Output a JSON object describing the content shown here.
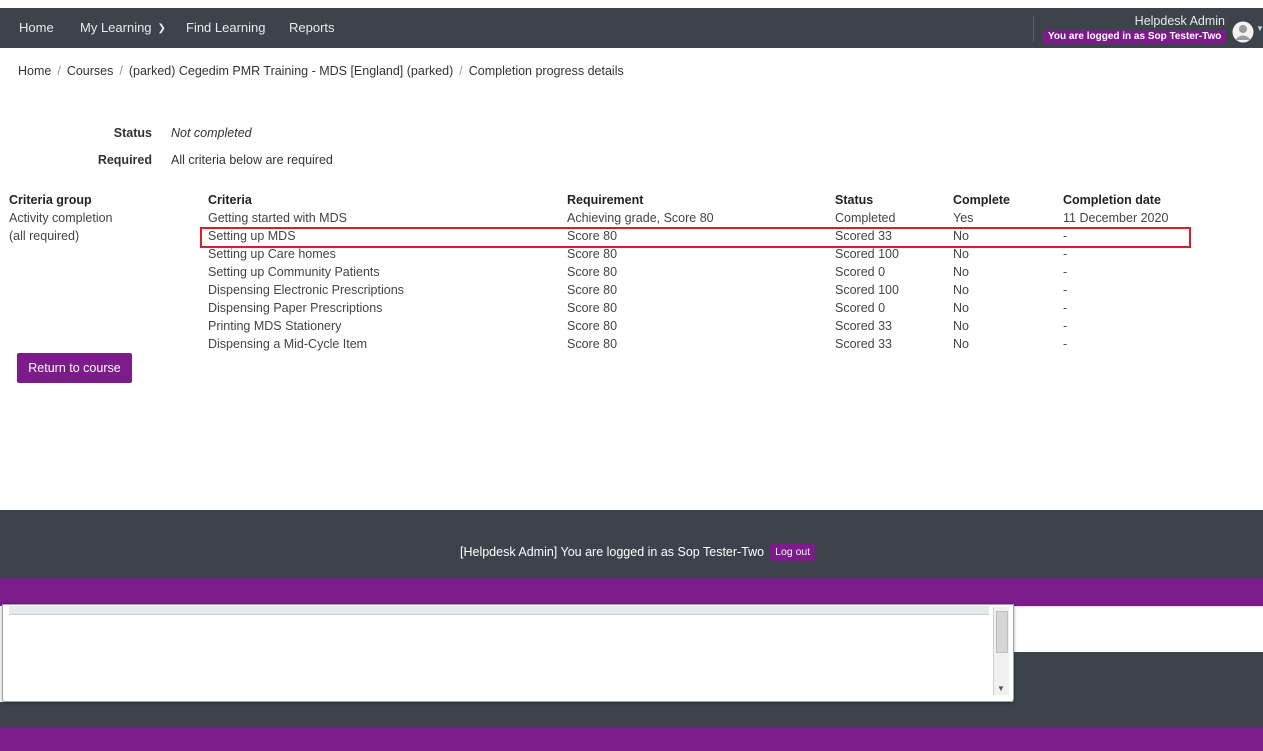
{
  "nav": {
    "items": [
      "Home",
      "My Learning",
      "Find Learning",
      "Reports"
    ],
    "user_name": "Helpdesk Admin",
    "logged_in_badge": "You are logged in as Sop Tester-Two"
  },
  "breadcrumb": [
    "Home",
    "Courses",
    "(parked) Cegedim PMR Training - MDS [England] (parked)",
    "Completion progress details"
  ],
  "info": {
    "status_label": "Status",
    "status_value": "Not completed",
    "required_label": "Required",
    "required_value": "All criteria below are required"
  },
  "table": {
    "headers": [
      "Criteria group",
      "Criteria",
      "Requirement",
      "Status",
      "Complete",
      "Completion date"
    ],
    "group": [
      "Activity completion",
      "(all required)"
    ],
    "rows": [
      {
        "criteria": "Getting started with MDS",
        "requirement": "Achieving grade, Score 80",
        "status": "Completed",
        "complete": "Yes",
        "date": "11 December 2020"
      },
      {
        "criteria": "Setting up MDS",
        "requirement": "Score 80",
        "status": "Scored 33",
        "complete": "No",
        "date": "-"
      },
      {
        "criteria": "Setting up Care homes",
        "requirement": "Score 80",
        "status": "Scored 100",
        "complete": "No",
        "date": "-"
      },
      {
        "criteria": "Setting up Community Patients",
        "requirement": "Score 80",
        "status": "Scored 0",
        "complete": "No",
        "date": "-"
      },
      {
        "criteria": "Dispensing Electronic Prescriptions",
        "requirement": "Score 80",
        "status": "Scored 100",
        "complete": "No",
        "date": "-"
      },
      {
        "criteria": "Dispensing Paper Prescriptions",
        "requirement": "Score 80",
        "status": "Scored 0",
        "complete": "No",
        "date": "-"
      },
      {
        "criteria": "Printing MDS Stationery",
        "requirement": "Score 80",
        "status": "Scored 33",
        "complete": "No",
        "date": "-"
      },
      {
        "criteria": "Dispensing a Mid-Cycle Item",
        "requirement": "Score 80",
        "status": "Scored 33",
        "complete": "No",
        "date": "-"
      }
    ]
  },
  "return_button": "Return to course",
  "footer": {
    "text": "[Helpdesk Admin] You are logged in as Sop Tester-Two",
    "logout": "Log out"
  },
  "colors": {
    "navbar": "#3d434b",
    "accent_purple": "#7c1b8a",
    "highlight_red": "#d91e27"
  }
}
